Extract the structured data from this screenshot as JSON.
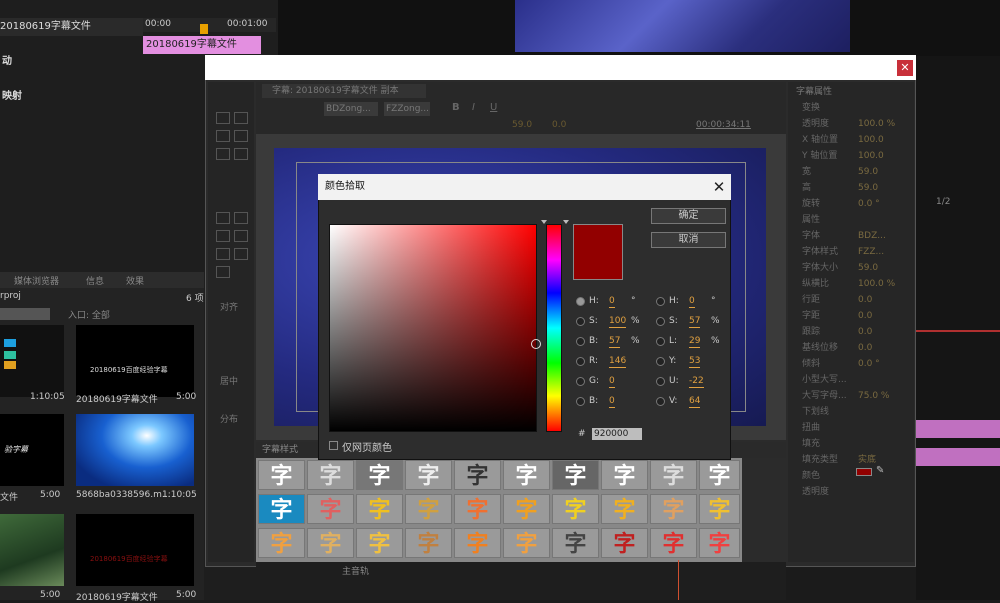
{
  "background": {
    "timeline": {
      "sequence_tab": "20180619字幕文件",
      "time_start": "00:00",
      "time_end": "00:01:00",
      "clip_label": "20180619字幕文件",
      "rows": [
        "动",
        "映射"
      ]
    },
    "project": {
      "tabs": [
        "媒体浏览器",
        "信息",
        "效果"
      ],
      "file": "rproj",
      "count": "6 项",
      "in_label": "入口: 全部",
      "items": [
        {
          "name": "",
          "duration": "1:10:05"
        },
        {
          "name": "20180619字幕文件",
          "duration": "5:00",
          "thumb_text": "20180619百度经验字幕"
        },
        {
          "name": "文件",
          "duration": "5:00",
          "thumb_text": "验字幕"
        },
        {
          "name": "5868ba0338596.m...",
          "duration": "1:10:05"
        },
        {
          "name": "",
          "duration": "5:00"
        },
        {
          "name": "20180619字幕文件",
          "duration": "5:00",
          "thumb_text": "20180619百度经验字幕"
        }
      ]
    }
  },
  "titler": {
    "tab": "字幕: 20180619字幕文件 副本",
    "font_family": "BDZong...",
    "font_style": "FZZong...",
    "font_size": "59.0",
    "leading": "0.0",
    "timecode": "00:00:34:11",
    "sections": [
      "对齐",
      "居中",
      "分布"
    ],
    "styles_tab": "字幕样式",
    "bottom_track": "主音轨",
    "props": {
      "title": "字幕属性",
      "rows": [
        {
          "label": "变换",
          "value": ""
        },
        {
          "label": "透明度",
          "value": "100.0 %"
        },
        {
          "label": "X 轴位置",
          "value": "100.0"
        },
        {
          "label": "Y 轴位置",
          "value": "100.0"
        },
        {
          "label": "宽",
          "value": "59.0"
        },
        {
          "label": "高",
          "value": "59.0"
        },
        {
          "label": "旋转",
          "value": "0.0 °"
        },
        {
          "label": "属性",
          "value": ""
        },
        {
          "label": "字体",
          "value": "BDZ..."
        },
        {
          "label": "字体样式",
          "value": "FZZ..."
        },
        {
          "label": "字体大小",
          "value": "59.0"
        },
        {
          "label": "纵横比",
          "value": "100.0 %"
        },
        {
          "label": "行距",
          "value": "0.0"
        },
        {
          "label": "字距",
          "value": "0.0"
        },
        {
          "label": "跟踪",
          "value": "0.0"
        },
        {
          "label": "基线位移",
          "value": "0.0"
        },
        {
          "label": "倾斜",
          "value": "0.0 °"
        },
        {
          "label": "小型大写...",
          "value": ""
        },
        {
          "label": "大写字母...",
          "value": "75.0 %"
        },
        {
          "label": "下划线",
          "value": ""
        },
        {
          "label": "扭曲",
          "value": ""
        },
        {
          "label": "填充",
          "value": ""
        },
        {
          "label": "填充类型",
          "value": "实底"
        },
        {
          "label": "颜色",
          "value": ""
        },
        {
          "label": "透明度",
          "value": ""
        }
      ]
    },
    "style_glyph": "字",
    "page_indicator": "1/2"
  },
  "color_picker": {
    "title": "颜色拾取",
    "ok_label": "确定",
    "cancel_label": "取消",
    "web_colors_label": "仅网页颜色",
    "hex_label": "#",
    "hex_value": "920000",
    "selected_color": "#920000",
    "left_fields": [
      {
        "label": "H:",
        "value": "0",
        "unit": "°",
        "selected": true
      },
      {
        "label": "S:",
        "value": "100",
        "unit": "%",
        "selected": false
      },
      {
        "label": "B:",
        "value": "57",
        "unit": "%",
        "selected": false
      },
      {
        "label": "R:",
        "value": "146",
        "unit": "",
        "selected": false
      },
      {
        "label": "G:",
        "value": "0",
        "unit": "",
        "selected": false
      },
      {
        "label": "B:",
        "value": "0",
        "unit": "",
        "selected": false
      }
    ],
    "right_fields": [
      {
        "label": "H:",
        "value": "0",
        "unit": "°"
      },
      {
        "label": "S:",
        "value": "57",
        "unit": "%"
      },
      {
        "label": "L:",
        "value": "29",
        "unit": "%"
      },
      {
        "label": "Y:",
        "value": "53",
        "unit": ""
      },
      {
        "label": "U:",
        "value": "-22",
        "unit": ""
      },
      {
        "label": "V:",
        "value": "64",
        "unit": ""
      }
    ]
  }
}
